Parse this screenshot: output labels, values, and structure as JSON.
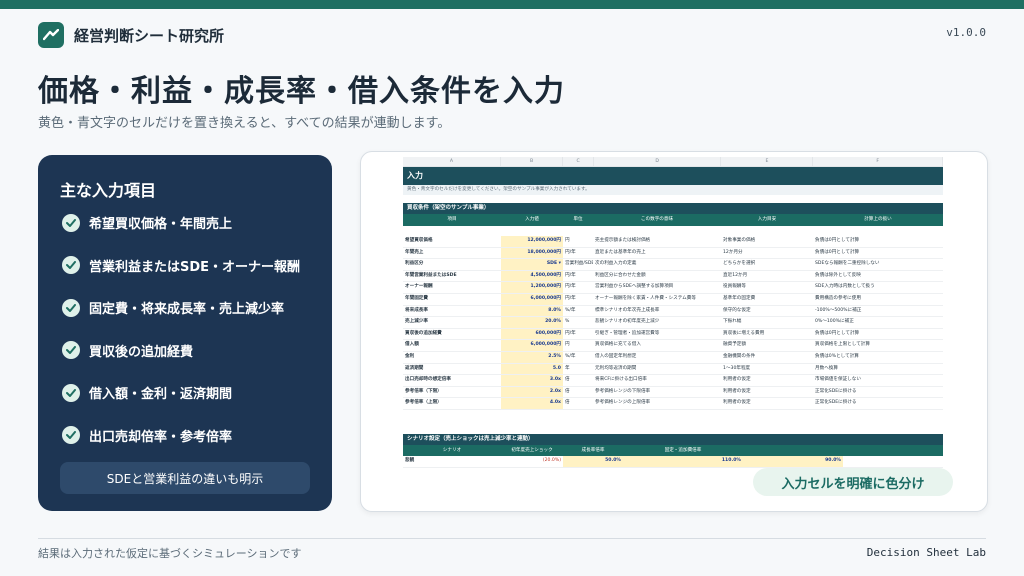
{
  "header": {
    "brand": "経営判断シート研究所",
    "version": "v1.0.0"
  },
  "hero": {
    "title": "価格・利益・成長率・借入条件を入力",
    "subtitle": "黄色・青文字のセルだけを置き換えると、すべての結果が連動します。"
  },
  "panel": {
    "title": "主な入力項目",
    "items": [
      "希望買収価格・年間売上",
      "営業利益またはSDE・オーナー報酬",
      "固定費・将来成長率・売上減少率",
      "買収後の追加経費",
      "借入額・金利・返済期間",
      "出口売却倍率・参考倍率"
    ],
    "button": "SDEと営業利益の違いも明示"
  },
  "sheet": {
    "columns": [
      "A",
      "B",
      "C",
      "D",
      "E",
      "F"
    ],
    "section1": "入力",
    "note": "黄色・青文字のセルだけを変更してください。架空のサンプル事業が入力されています。",
    "section2": "買収条件（架空のサンプル事業）",
    "headers": [
      "項目",
      "入力値",
      "単位",
      "この数字の意味",
      "入力目安",
      "計算上の扱い"
    ],
    "rows": [
      {
        "label": "希望買収価格",
        "value": "12,000,000円",
        "unit": "円",
        "meaning": "売主提示額または検討価格",
        "guide": "対象事業の価格",
        "calc": "負債は0円として計算"
      },
      {
        "label": "年間売上",
        "value": "18,000,000円",
        "unit": "円/年",
        "meaning": "直近または基準年の売上",
        "guide": "12か月分",
        "calc": "負債は0円として計算"
      },
      {
        "label": "利益区分",
        "value": "SDE ▾",
        "unit": "営業利益/SDE",
        "meaning": "次の利益入力の定義",
        "guide": "どちらかを選択",
        "calc": "SDEなら報酬を二重控除しない"
      },
      {
        "label": "年間営業利益またはSDE",
        "value": "4,500,000円",
        "unit": "円/年",
        "meaning": "利益区分に合わせた金額",
        "guide": "直近12か月",
        "calc": "負債は除外として反映"
      },
      {
        "label": "オーナー報酬",
        "value": "1,200,000円",
        "unit": "円/年",
        "meaning": "営業利益からSDEへ調整する加算項目",
        "guide": "役員報酬等",
        "calc": "SDE入力時は内数として扱う"
      },
      {
        "label": "年間固定費",
        "value": "6,000,000円",
        "unit": "円/年",
        "meaning": "オーナー報酬を除く家賃・人件費・システム費等",
        "guide": "基準年の固定費",
        "calc": "費用構造の参考に使用"
      },
      {
        "label": "将来成長率",
        "value": "8.0%",
        "unit": "%/年",
        "meaning": "標準シナリオの年次売上成長率",
        "guide": "保守的な仮定",
        "calc": "-100%〜500%に補正"
      },
      {
        "label": "売上減少率",
        "value": "20.0%",
        "unit": "%",
        "meaning": "悲観シナリオの初年度売上減少",
        "guide": "下振れ幅",
        "calc": "0%〜100%に補正"
      },
      {
        "label": "買収後の追加経費",
        "value": "600,000円",
        "unit": "円/年",
        "meaning": "引継ぎ・管理者・追加運営費等",
        "guide": "買収後に増える費用",
        "calc": "負債は0円として計算"
      },
      {
        "label": "借入額",
        "value": "6,000,000円",
        "unit": "円",
        "meaning": "買収価格に充てる借入",
        "guide": "融資予定額",
        "calc": "買収価格を上限として計算"
      },
      {
        "label": "金利",
        "value": "2.5%",
        "unit": "%/年",
        "meaning": "借入の固定年利想定",
        "guide": "金融機関の条件",
        "calc": "負債は0%として計算"
      },
      {
        "label": "返済期間",
        "value": "5.0",
        "unit": "年",
        "meaning": "元利均等返済の期間",
        "guide": "1〜30年程度",
        "calc": "月数へ換算"
      },
      {
        "label": "出口売却時の想定倍率",
        "value": "3.0x",
        "unit": "倍",
        "meaning": "将来CFに掛ける出口倍率",
        "guide": "利用者の仮定",
        "calc": "市場価値を保証しない"
      },
      {
        "label": "参考倍率（下限）",
        "value": "2.0x",
        "unit": "倍",
        "meaning": "参考価格レンジの下限倍率",
        "guide": "利用者の仮定",
        "calc": "正常化SDEに掛ける"
      },
      {
        "label": "参考倍率（上限）",
        "value": "4.0x",
        "unit": "倍",
        "meaning": "参考価格レンジの上限倍率",
        "guide": "利用者の仮定",
        "calc": "正常化SDEに掛ける"
      }
    ],
    "section3": "シナリオ設定（売上ショックは売上減少率と連動）",
    "scenario_headers": [
      "シナリオ",
      "初年度売上ショック",
      "成長率倍率",
      "固定・追加費倍率",
      ""
    ],
    "scenario_row": {
      "name": "悲観",
      "shock": "(20.0%)",
      "growth": "50.0%",
      "cost": "110.0%",
      "extra": "90.0%"
    }
  },
  "callout": "入力セルを明確に色分け",
  "footer": {
    "note": "結果は入力された仮定に基づくシミュレーションです",
    "brand": "Decision Sheet Lab"
  },
  "colors": {
    "accent": "#1f6f62",
    "panel": "#1d3553",
    "input_cell": "#fff2c4"
  },
  "icons": [
    "logo-mark-icon",
    "check-circle-icon"
  ]
}
